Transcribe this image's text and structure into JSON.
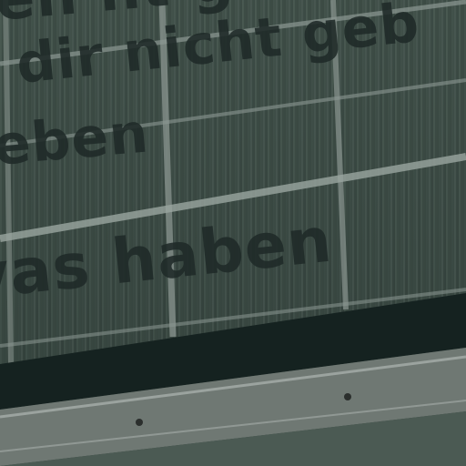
{
  "sign": {
    "line1": "en         ht geb",
    "line2": "dir nicht geb",
    "line3": "eben",
    "line4": "vas haben"
  },
  "colors": {
    "glass": "#3b4a44",
    "frame": "#8a9590",
    "text": "#1f2a28",
    "band": "#152220",
    "rail": "#7d8580"
  }
}
